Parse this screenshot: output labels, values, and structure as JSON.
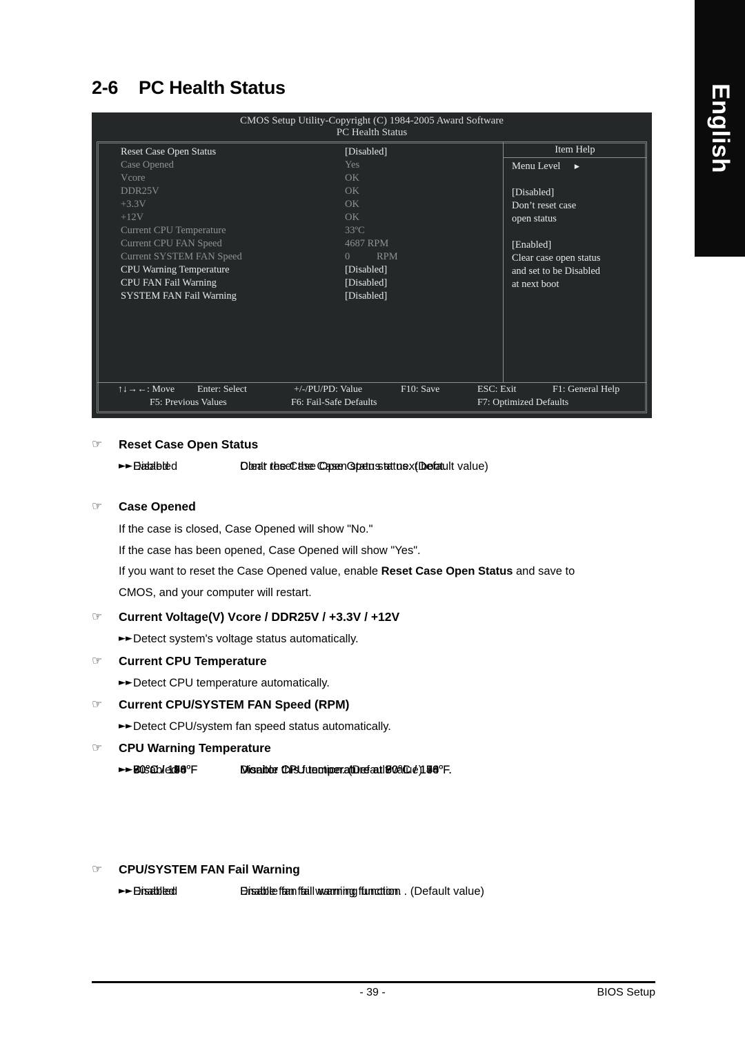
{
  "language_tab": "English",
  "heading": {
    "number": "2-6",
    "title": "PC Health Status"
  },
  "bios": {
    "title_line1": "CMOS Setup Utility-Copyright (C) 1984-2005 Award Software",
    "title_line2": "PC Health Status",
    "items": [
      {
        "label": "Reset Case Open Status",
        "value": "[Disabled]",
        "style": "bright"
      },
      {
        "label": "Case Opened",
        "value": "Yes",
        "style": "dim"
      },
      {
        "label": "Vcore",
        "value": "OK",
        "style": "dim"
      },
      {
        "label": "DDR25V",
        "value": "OK",
        "style": "dim"
      },
      {
        "label": "+3.3V",
        "value": "OK",
        "style": "dim"
      },
      {
        "label": "+12V",
        "value": "OK",
        "style": "dim"
      },
      {
        "label": "Current CPU Temperature",
        "value": "33ºC",
        "style": "dim"
      },
      {
        "label": "Current CPU FAN Speed",
        "value": "4687 RPM",
        "style": "dim"
      },
      {
        "label": "Current SYSTEM FAN Speed",
        "value": "0",
        "value2": "RPM",
        "style": "dim"
      },
      {
        "label": "CPU Warning Temperature",
        "value": "[Disabled]",
        "style": "bright"
      },
      {
        "label": "CPU FAN Fail Warning",
        "value": "[Disabled]",
        "style": "bright"
      },
      {
        "label": "SYSTEM FAN Fail Warning",
        "value": "[Disabled]",
        "style": "bright"
      }
    ],
    "help": {
      "title": "Item Help",
      "menu_level": "Menu Level",
      "lines": [
        "[Disabled]",
        "Don’t reset case",
        "open status",
        "",
        "[Enabled]",
        "Clear case open status",
        "and set to be Disabled",
        "at next boot"
      ]
    },
    "keys": {
      "move": "↑↓→←: Move",
      "enter": "Enter: Select",
      "value": "+/-/PU/PD: Value",
      "f10": "F10: Save",
      "esc": "ESC: Exit",
      "f1": "F1: General Help",
      "f5": "F5: Previous Values",
      "f6": "F6: Fail-Safe Defaults",
      "f7": "F7: Optimized Defaults"
    }
  },
  "sections": {
    "reset_case_open": {
      "title": "Reset Case Open Status",
      "rows": [
        {
          "option": "Disabled",
          "desc": "Don't reset the Case Open status. (Default value)"
        },
        {
          "option": "Eabled",
          "desc": "Clear the Case Open status at next boot."
        }
      ]
    },
    "case_opened": {
      "title": "Case Opened",
      "line1": "If the case is closed, Case Opened will show \"No.\"",
      "line2": "If the case has been opened, Case Opened will show \"Yes\".",
      "line3_a": "If you want to reset the Case Opened value, enable ",
      "line3_b": "Reset Case Open Status",
      "line3_c": " and save to",
      "line4": "CMOS, and your computer will restart."
    },
    "current_voltage": {
      "title": "Current Voltage(V) Vcore / DDR25V / +3.3V / +12V",
      "desc": "Detect system's voltage status automatically."
    },
    "current_cpu_temp": {
      "title": "Current CPU Temperature",
      "desc": "Detect CPU temperature automatically."
    },
    "current_fan_speed": {
      "title": "Current CPU/SYSTEM FAN Speed (RPM)",
      "desc": "Detect CPU/system fan speed status automatically."
    },
    "cpu_warning_temp": {
      "title": "CPU Warning Temperature",
      "rows": [
        {
          "opt_num": "60",
          "opt_f": "140",
          "desc_num": "60",
          "desc_f": "140"
        },
        {
          "opt_num": "70",
          "opt_f": "158",
          "desc_num": "70",
          "desc_f": "158"
        },
        {
          "opt_num": "80",
          "opt_f": "176",
          "desc_num": "80",
          "desc_f": "176"
        },
        {
          "opt_num": "90",
          "opt_f": "194",
          "desc_num": "90",
          "desc_f": "194"
        }
      ],
      "disabled_option": "Disabled",
      "disabled_desc": "Disable this function. (Default value)"
    },
    "fan_fail_warning": {
      "title": "CPU/SYSTEM FAN Fail Warning",
      "rows": [
        {
          "option": "Disabled",
          "desc": "Disable fan fail warning function . (Default value)"
        },
        {
          "option": "Enabled",
          "desc": "Enable fan fail warning function."
        }
      ]
    }
  },
  "footer": {
    "page": "- 39 -",
    "right": "BIOS Setup"
  }
}
